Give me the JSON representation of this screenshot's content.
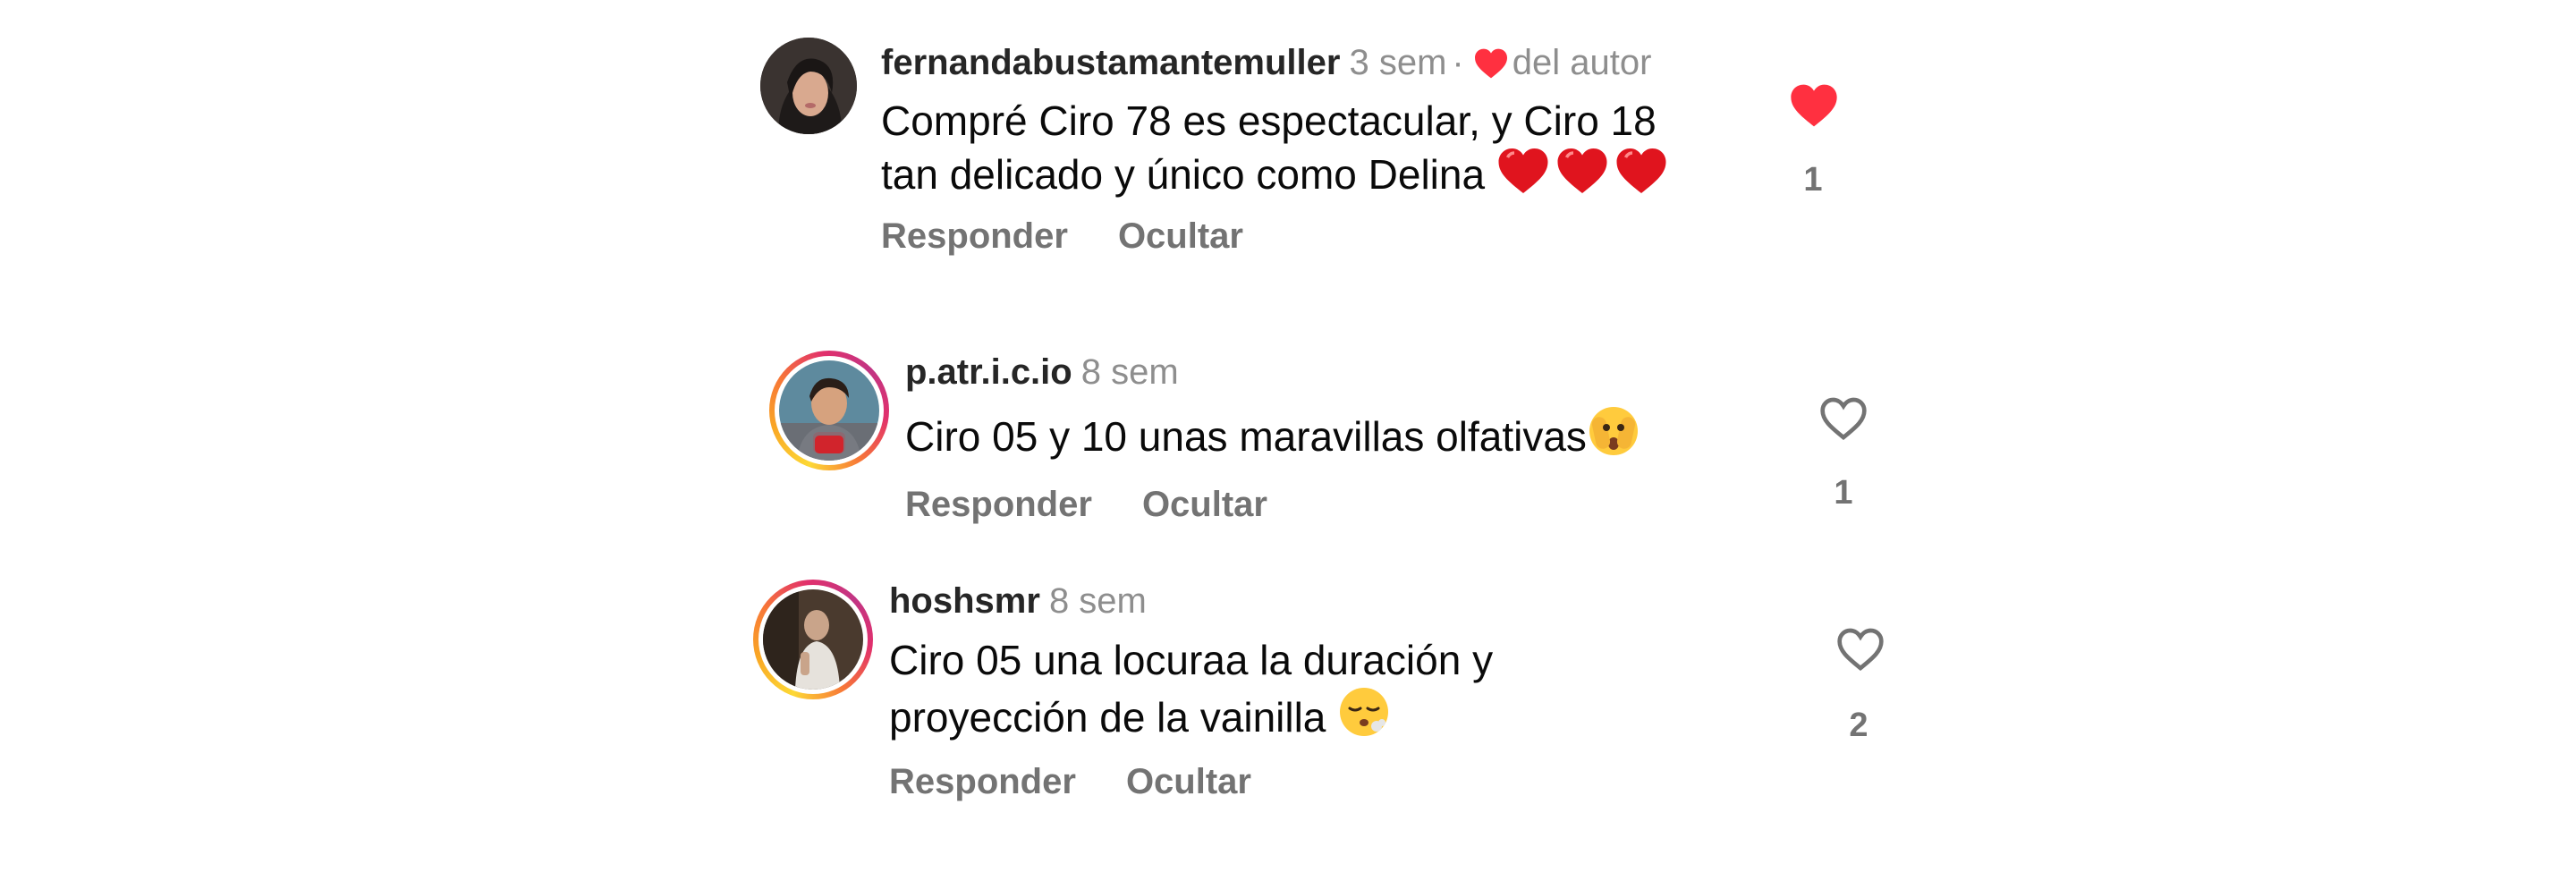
{
  "comments": [
    {
      "username": "fernandabustamantemuller",
      "time": "3 sem",
      "separator": "·",
      "author_badge": "del autor",
      "text_line1": "Compré Ciro 78 es espectacular, y Ciro 18",
      "text_line2": "tan delicado y único como Delina",
      "reply": "Responder",
      "hide": "Ocultar",
      "likes": "1",
      "liked": true
    },
    {
      "username": "p.atr.i.c.io",
      "time": "8 sem",
      "text_line1": "Ciro 05 y 10 unas maravillas olfativas",
      "reply": "Responder",
      "hide": "Ocultar",
      "likes": "1",
      "liked": false
    },
    {
      "username": "hoshsmr",
      "time": "8 sem",
      "text_line1": "Ciro 05 una locuraa la duración y",
      "text_line2": "proyección de la vainilla",
      "reply": "Responder",
      "hide": "Ocultar",
      "likes": "2",
      "liked": false
    }
  ],
  "icons": {
    "liked_heart": "heart-filled-icon",
    "unliked_heart": "heart-outline-icon",
    "heart_emoji": "red-heart-emoji",
    "peeking_emoji": "face-with-peeking-eye-emoji",
    "sighing_emoji": "face-exhaling-emoji"
  },
  "colors": {
    "like_red": "#ff3040",
    "muted_gray": "#737373",
    "text": "#0a0a0a"
  }
}
